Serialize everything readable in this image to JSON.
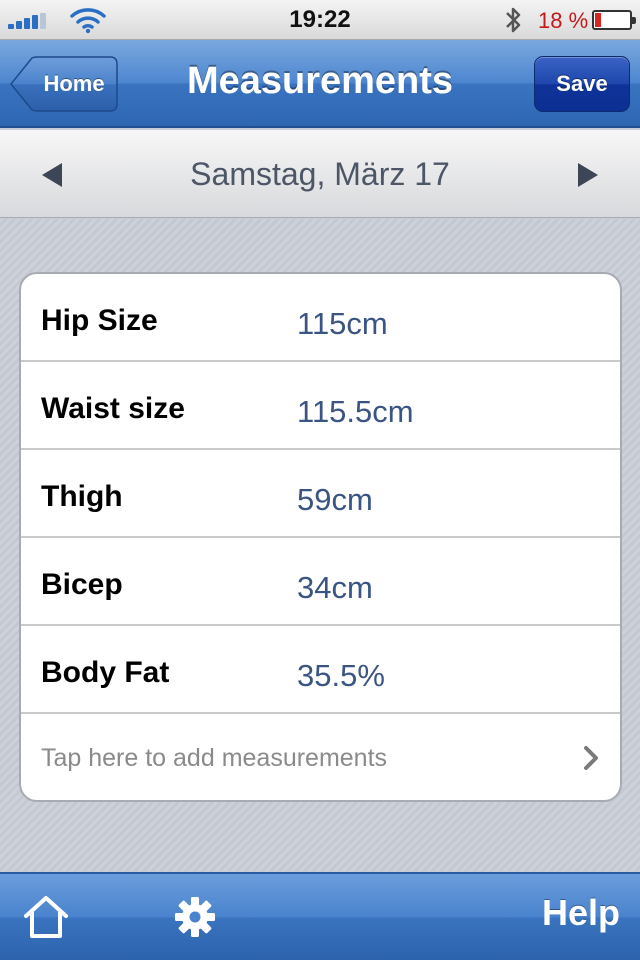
{
  "status_bar": {
    "time": "19:22",
    "battery_percent": "18 %",
    "battery_level": 0.18,
    "signal_bars": 4
  },
  "nav": {
    "title": "Measurements",
    "back_label": "Home",
    "save_label": "Save"
  },
  "date_bar": {
    "date": "Samstag, März 17"
  },
  "measurements": [
    {
      "label": "Hip Size",
      "value": "115cm"
    },
    {
      "label": "Waist size",
      "value": "115.5cm"
    },
    {
      "label": "Thigh",
      "value": "59cm"
    },
    {
      "label": "Bicep",
      "value": "34cm"
    },
    {
      "label": "Body Fat",
      "value": "35.5%"
    }
  ],
  "add_row": {
    "label": "Tap here to add measurements"
  },
  "toolbar": {
    "help_label": "Help",
    "icons": [
      "home-icon",
      "gear-icon"
    ]
  },
  "colors": {
    "nav_blue": "#3a74c1",
    "save_blue": "#0f3398",
    "value_text": "#3a5484",
    "battery_red": "#d6261f"
  }
}
